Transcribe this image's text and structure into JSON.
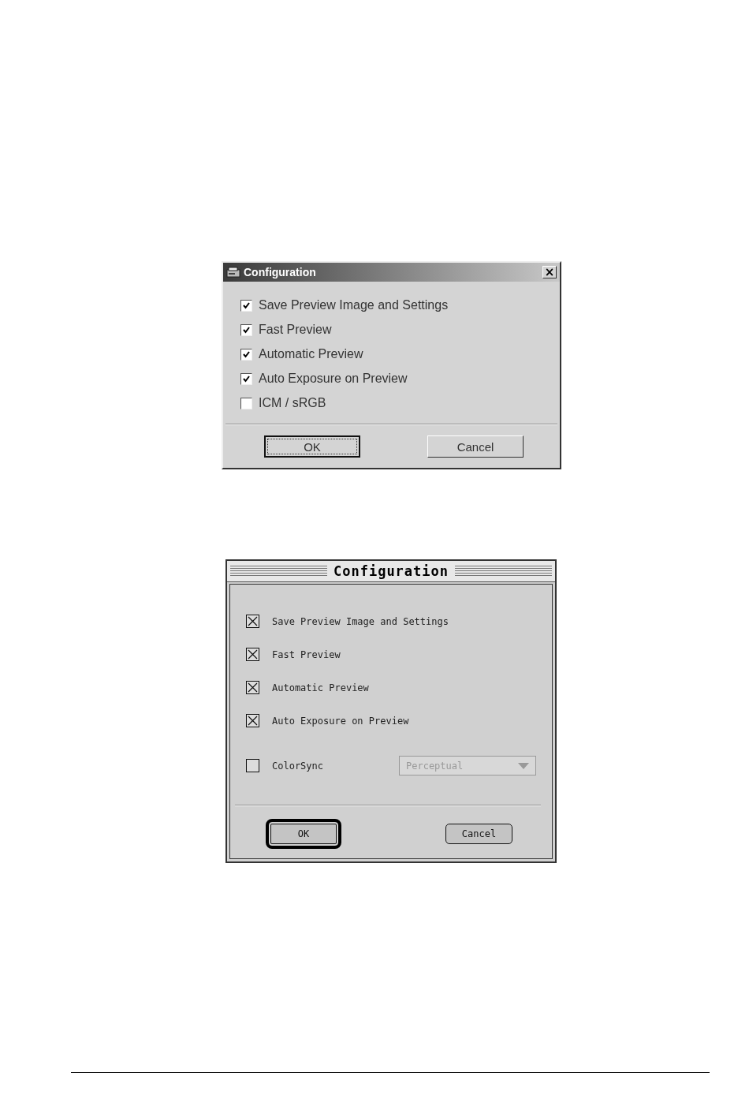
{
  "windows_dialog": {
    "title": "Configuration",
    "close_label": "×",
    "options": [
      {
        "label": "Save Preview Image and Settings",
        "checked": true
      },
      {
        "label": "Fast Preview",
        "checked": true
      },
      {
        "label": "Automatic Preview",
        "checked": true
      },
      {
        "label": "Auto Exposure on Preview",
        "checked": true
      },
      {
        "label": "ICM / sRGB",
        "checked": false
      }
    ],
    "buttons": [
      {
        "label": "OK",
        "focused": true
      },
      {
        "label": "Cancel",
        "focused": false
      }
    ]
  },
  "mac_dialog": {
    "title": "Configuration",
    "options": [
      {
        "label": "Save Preview Image and Settings",
        "checked": true
      },
      {
        "label": "Fast Preview",
        "checked": true
      },
      {
        "label": "Automatic Preview",
        "checked": true
      },
      {
        "label": "Auto Exposure on Preview",
        "checked": true
      },
      {
        "label": "ColorSync",
        "checked": false,
        "dropdown": {
          "value": "Perceptual",
          "disabled": true
        }
      }
    ],
    "buttons": [
      {
        "label": "OK",
        "default": true
      },
      {
        "label": "Cancel",
        "default": false
      }
    ]
  }
}
